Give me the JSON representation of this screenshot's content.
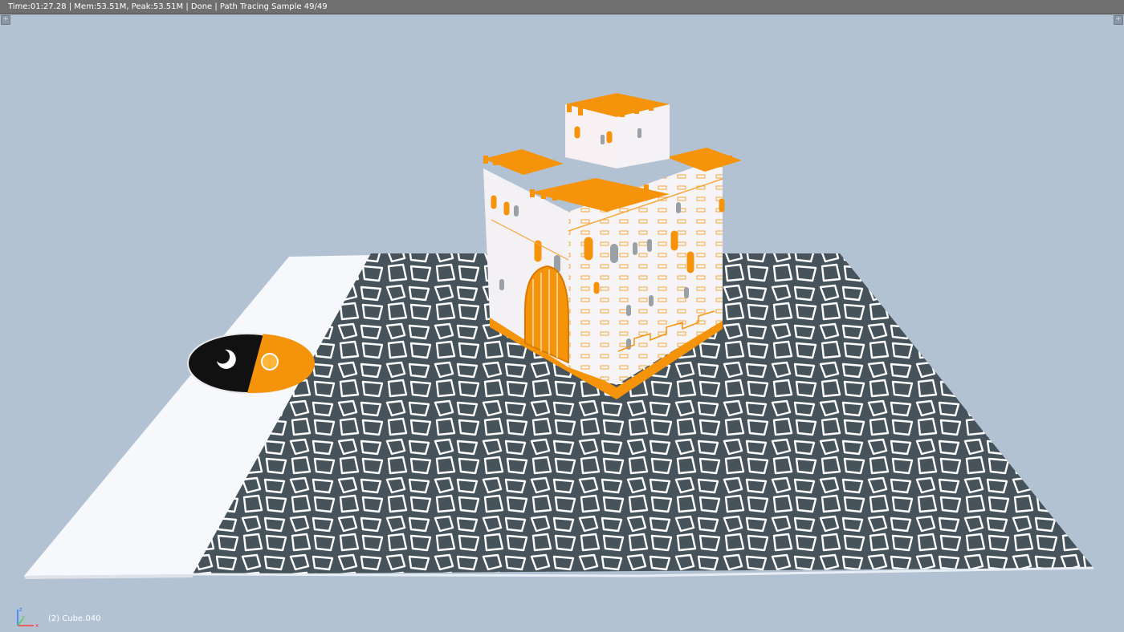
{
  "header": {
    "render_stats": "Time:01:27.28 | Mem:53.51M, Peak:53.51M | Done | Path Tracing Sample 49/49"
  },
  "viewport": {
    "object_label": "(2) Cube.040",
    "axis": {
      "z": "z",
      "y": "y",
      "x": "x"
    }
  },
  "colors": {
    "background": "#b3c2d2",
    "header_bar": "#6f6f70",
    "ground": "#47535b",
    "stone_lines": "#ffffff",
    "accent_orange": "#f5930a",
    "wall_white": "#f4f4f6",
    "side_strip": "#f6f8fb"
  },
  "icons": [
    "corner-plus-icon",
    "axis-gizmo-icon"
  ]
}
